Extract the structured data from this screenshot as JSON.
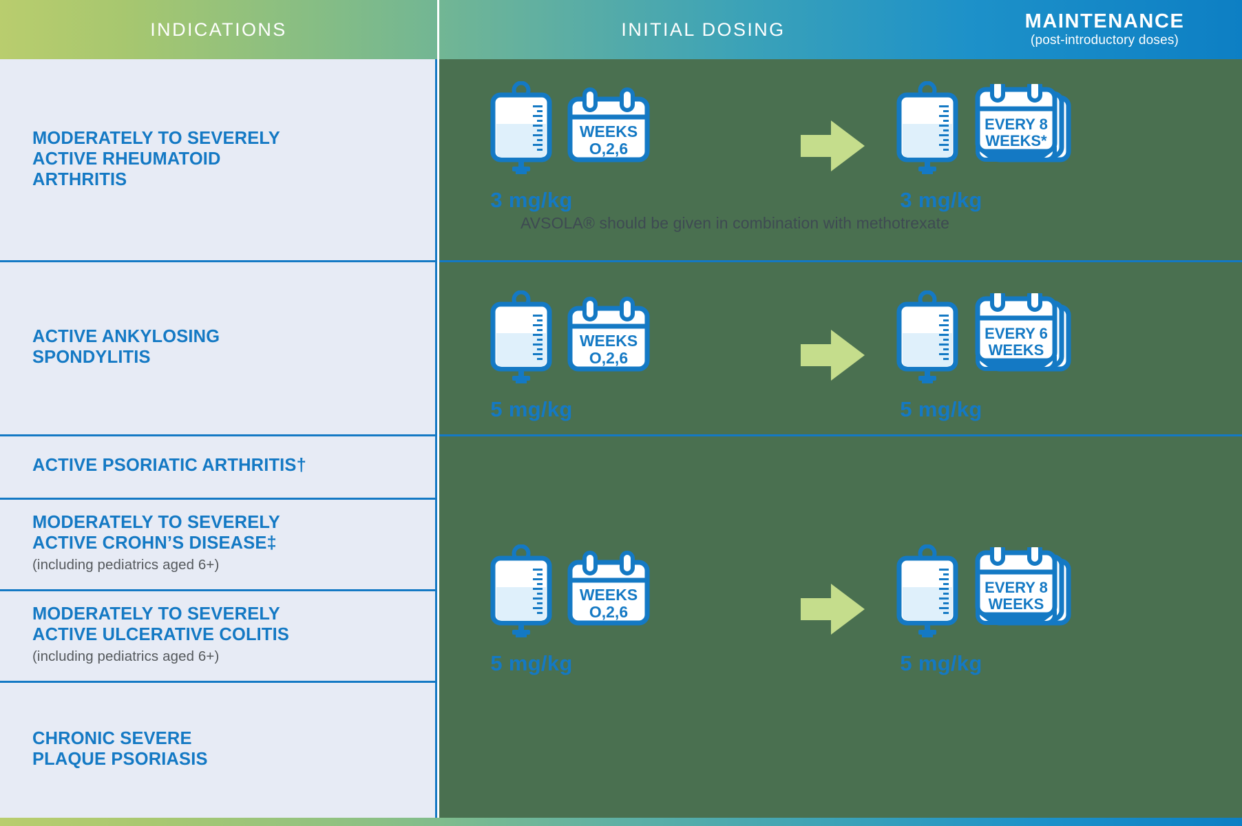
{
  "header": {
    "indications_label": "INDICATIONS",
    "initial_label": "INITIAL DOSING",
    "maintenance_label": "MAINTENANCE",
    "maintenance_sub": "(post-introductory doses)"
  },
  "colors": {
    "brand_blue": "#1479c4",
    "panel_green": "#4a7050",
    "row_bg": "#e7ebf5",
    "arrow_green": "#c5dd8c",
    "bag_fill": "#e0eefa",
    "sub_text_gray": "#54585c",
    "note_gray": "#3e4a52",
    "gradient_start": "#b9cd6e",
    "gradient_end": "#0d7fc4"
  },
  "indications": [
    {
      "id": "rheumatoid-arthritis",
      "title": "MODERATELY TO SEVERELY ACTIVE RHEUMATOID ARTHRITIS",
      "lines": [
        "MODERATELY TO SEVERELY",
        "ACTIVE RHEUMATOID",
        "ARTHRITIS"
      ],
      "sub": ""
    },
    {
      "id": "ankylosing-spondylitis",
      "title": "ACTIVE ANKYLOSING SPONDYLITIS",
      "lines": [
        "ACTIVE ANKYLOSING",
        "SPONDYLITIS"
      ],
      "sub": ""
    },
    {
      "id": "psoriatic-arthritis",
      "title": "ACTIVE PSORIATIC ARTHRITIS†",
      "lines": [
        "ACTIVE PSORIATIC ARTHRITIS†"
      ],
      "sub": ""
    },
    {
      "id": "crohns-disease",
      "title": "MODERATELY TO SEVERELY ACTIVE CROHN’S DISEASE‡",
      "lines": [
        "MODERATELY TO SEVERELY",
        "ACTIVE CROHN’S DISEASE‡"
      ],
      "sub": "(including pediatrics aged 6+)"
    },
    {
      "id": "ulcerative-colitis",
      "title": "MODERATELY TO SEVERELY ACTIVE ULCERATIVE COLITIS",
      "lines": [
        "MODERATELY TO SEVERELY",
        "ACTIVE ULCERATIVE COLITIS"
      ],
      "sub": "(including pediatrics aged 6+)"
    },
    {
      "id": "plaque-psoriasis",
      "title": "CHRONIC SEVERE PLAQUE PSORIASIS",
      "lines": [
        "CHRONIC SEVERE",
        "PLAQUE PSORIASIS"
      ],
      "sub": ""
    }
  ],
  "regimens": [
    {
      "id": "regimen-ra",
      "initial_dose": "3 mg/kg",
      "initial_calendar_line1": "WEEKS",
      "initial_calendar_line2": "O,2,6",
      "maintenance_dose": "3 mg/kg",
      "maintenance_calendar_line1": "EVERY 8",
      "maintenance_calendar_line2": "WEEKS*",
      "note": "AVSOLA® should be given in combination with methotrexate"
    },
    {
      "id": "regimen-as",
      "initial_dose": "5 mg/kg",
      "initial_calendar_line1": "WEEKS",
      "initial_calendar_line2": "O,2,6",
      "maintenance_dose": "5 mg/kg",
      "maintenance_calendar_line1": "EVERY 6",
      "maintenance_calendar_line2": "WEEKS",
      "note": ""
    },
    {
      "id": "regimen-other",
      "initial_dose": "5 mg/kg",
      "initial_calendar_line1": "WEEKS",
      "initial_calendar_line2": "O,2,6",
      "maintenance_dose": "5 mg/kg",
      "maintenance_calendar_line1": "EVERY 8",
      "maintenance_calendar_line2": "WEEKS",
      "note": ""
    }
  ],
  "icons": {
    "iv_bag": "iv-bag-icon",
    "calendar": "calendar-icon",
    "calendar_stack": "calendar-stack-icon",
    "arrow": "arrow-right-icon"
  }
}
